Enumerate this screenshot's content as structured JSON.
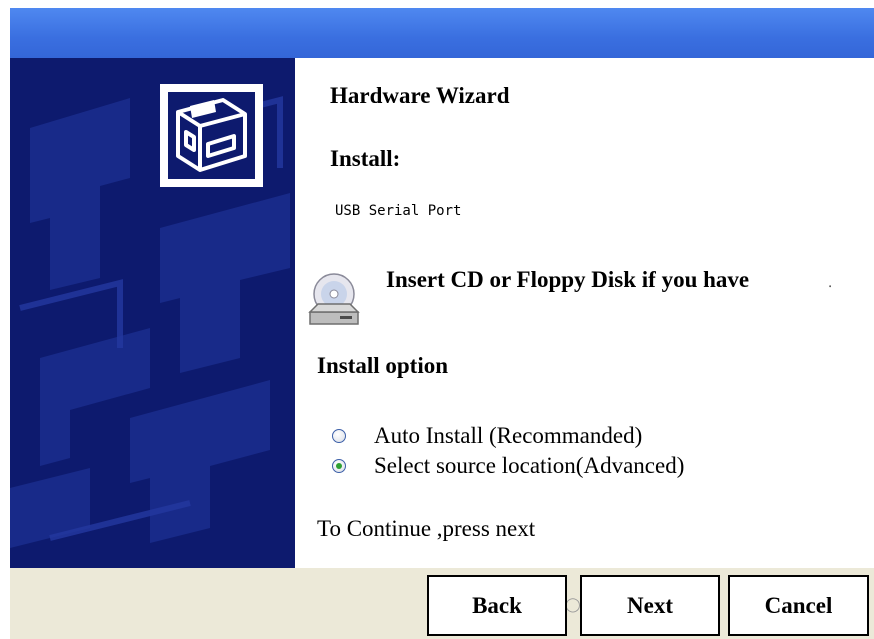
{
  "header": {
    "title": "Hardware Wizard",
    "install_label": "Install:",
    "device_name": "USB Serial Port"
  },
  "media_prompt": {
    "text": "Insert CD or Floppy Disk if you have",
    "icon": "cd-drive-icon"
  },
  "install_option": {
    "label": "Install option",
    "options": [
      {
        "label": "Auto Install (Recommanded)",
        "selected": false
      },
      {
        "label": "Select source location(Advanced)",
        "selected": true
      }
    ]
  },
  "footer_hint": "To Continue ,press next",
  "buttons": {
    "back": "Back",
    "next": "Next",
    "cancel": "Cancel"
  },
  "icons": {
    "wizard": "hardware-drive-bay-icon",
    "radio_checked_color": "#2ea032"
  },
  "colors": {
    "titlebar": "#3a6fe0",
    "side_panel": "#0d1a6e",
    "button_bar": "#ece9d8"
  }
}
